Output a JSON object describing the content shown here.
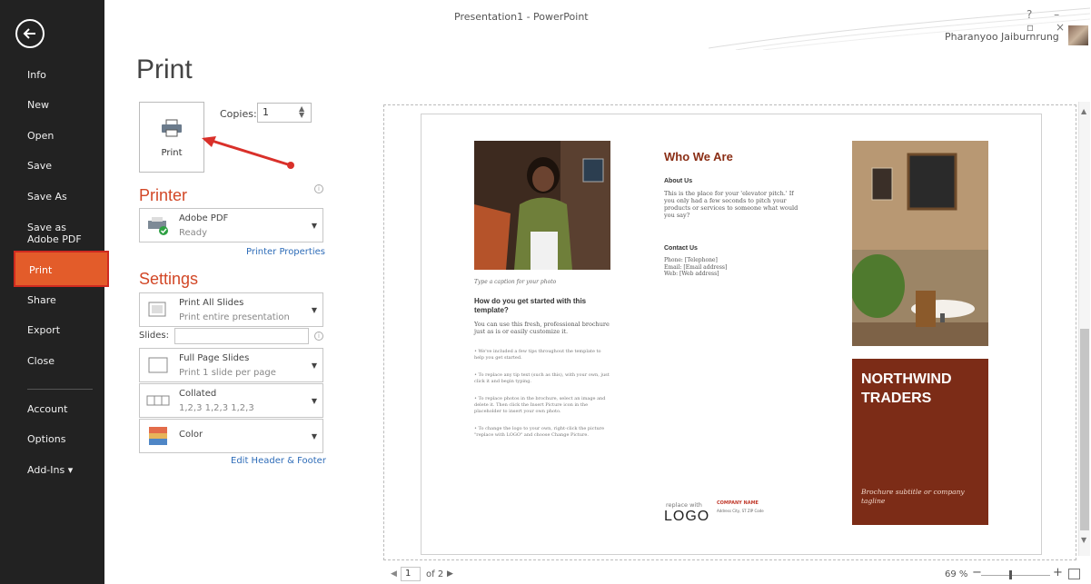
{
  "window": {
    "title": "Presentation1 - PowerPoint",
    "controls": "? – ▫ ×",
    "user": "Pharanyoo Jaiburnrung"
  },
  "sidebar": {
    "items": [
      {
        "label": "Info"
      },
      {
        "label": "New"
      },
      {
        "label": "Open"
      },
      {
        "label": "Save"
      },
      {
        "label": "Save As"
      },
      {
        "label": "Save as Adobe PDF"
      },
      {
        "label": "Print",
        "active": true
      },
      {
        "label": "Share"
      },
      {
        "label": "Export"
      },
      {
        "label": "Close"
      },
      {
        "label": "Account"
      },
      {
        "label": "Options"
      },
      {
        "label": "Add-Ins ▾"
      }
    ]
  },
  "print": {
    "title": "Print",
    "button_label": "Print",
    "copies_label": "Copies:",
    "copies_value": "1"
  },
  "printer": {
    "heading": "Printer",
    "name": "Adobe PDF",
    "status": "Ready",
    "properties_link": "Printer Properties"
  },
  "settings": {
    "heading": "Settings",
    "range_title": "Print All Slides",
    "range_sub": "Print entire presentation",
    "slides_label": "Slides:",
    "layout_title": "Full Page Slides",
    "layout_sub": "Print 1 slide per page",
    "collate_title": "Collated",
    "collate_sub": "1,2,3   1,2,3   1,2,3",
    "color_title": "Color",
    "header_footer_link": "Edit Header & Footer"
  },
  "preview": {
    "caption": "Type a caption for your photo",
    "start_heading": "How do you get started with this template?",
    "start_text": "You can use this fresh, professional brochure just as is or easily customize it.",
    "bullets": [
      "We've included a few tips throughout the template to help you get started.",
      "To replace any tip text (such as this), with your own, just click it and begin typing.",
      "To replace photos in the brochure, select an image and delete it. Then click the Insert Picture icon in the placeholder to insert your own photo.",
      "To change the logo to your own, right-click the picture \"replace with LOGO\" and choose Change Picture."
    ],
    "who_we_are": "Who We Are",
    "about_heading": "About Us",
    "about_text": "This is the place for your 'elevator pitch.' If you only had a few seconds to pitch your products or services to someone what would you say?",
    "contact_heading": "Contact Us",
    "contact_lines": "Phone: [Telephone]\nEmail: [Email address]\nWeb: [Web address]",
    "logo_small": "replace with",
    "logo_big": "LOGO",
    "company_name": "COMPANY NAME",
    "company_address": "Address City, ST ZIP Code",
    "brand_title": "NORTHWIND TRADERS",
    "brand_subtitle": "Brochure subtitle or company tagline"
  },
  "pager": {
    "current": "1",
    "of": "of 2"
  },
  "zoom": {
    "level": "69 %",
    "fraction": 0.42
  },
  "colors": {
    "sidebar_bg": "#222222",
    "accent": "#d24726",
    "active_item": "#e35c2a",
    "brand_box": "#7c2c17",
    "link": "#2e6cb8"
  }
}
